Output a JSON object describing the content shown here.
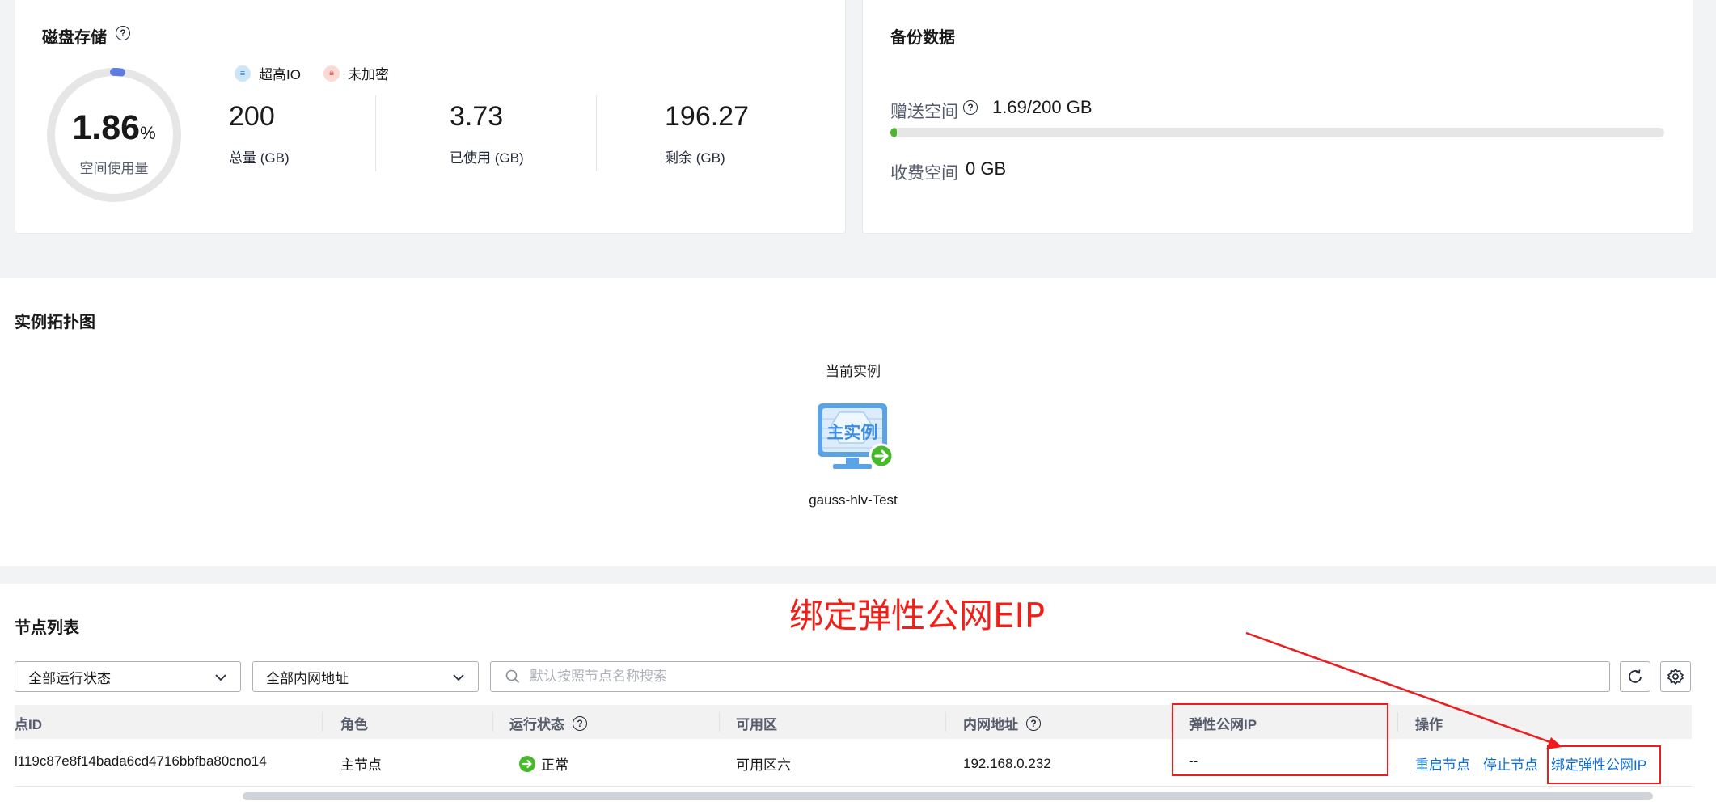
{
  "disk_storage": {
    "title": "磁盘存储",
    "usage_percent": 1.86,
    "usage_value": "1.86",
    "usage_unit": "%",
    "usage_label": "空间使用量",
    "tags": [
      {
        "label": "超高IO",
        "icon": "disk-icon",
        "color": "#7fbde8"
      },
      {
        "label": "未加密",
        "icon": "lock-icon",
        "color": "#f0a8a0"
      }
    ],
    "stats": [
      {
        "value": "200",
        "label": "总量 (GB)"
      },
      {
        "value": "3.73",
        "label": "已使用 (GB)"
      },
      {
        "value": "196.27",
        "label": "剩余 (GB)"
      }
    ]
  },
  "backup": {
    "title": "备份数据",
    "free_label": "赠送空间",
    "free_value": "1.69/200 GB",
    "free_used_fraction": 0.00845,
    "paid_label": "收费空间",
    "paid_value": "0 GB"
  },
  "topology": {
    "title": "实例拓扑图",
    "current_label": "当前实例",
    "instance_badge": "主实例",
    "instance_name": "gauss-hlv-Test"
  },
  "node_list": {
    "title": "节点列表",
    "filter_status": "全部运行状态",
    "filter_address": "全部内网地址",
    "search_placeholder": "默认按照节点名称搜索",
    "columns": [
      "点ID",
      "角色",
      "运行状态",
      "可用区",
      "内网地址",
      "弹性公网IP",
      "操作"
    ],
    "rows": [
      {
        "id": "l119c87e8f14bada6cd4716bbfba80cno14",
        "role": "主节点",
        "status": "正常",
        "zone": "可用区六",
        "address": "192.168.0.232",
        "eip": "--",
        "actions": [
          "重启节点",
          "停止节点",
          "绑定弹性公网IP"
        ]
      }
    ]
  },
  "annotation": {
    "text": "绑定弹性公网EIP",
    "color": "#ee1c1c"
  },
  "colors": {
    "accent_link": "#0a6cd9",
    "status_ok": "#48b82c",
    "ring_progress": "#5e7ce0"
  }
}
